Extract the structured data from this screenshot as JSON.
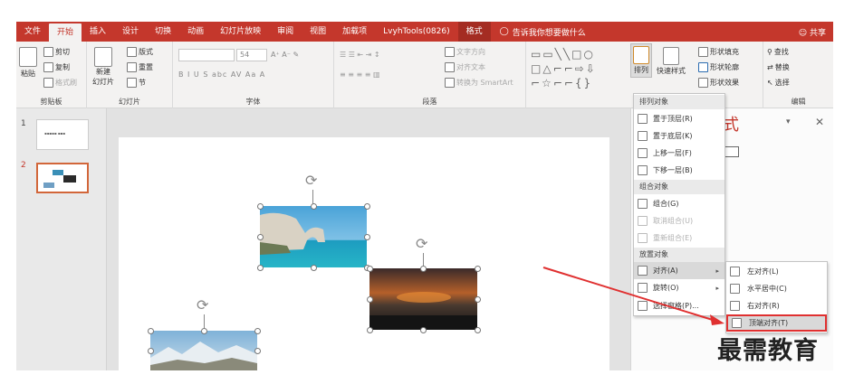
{
  "ribbon_tabs": [
    "文件",
    "开始",
    "插入",
    "设计",
    "切换",
    "动画",
    "幻灯片放映",
    "审阅",
    "视图",
    "加载项",
    "LvyhTools(0826)",
    "格式"
  ],
  "tell_me": "告诉我你想要做什么",
  "share": "共享",
  "clipboard": {
    "paste": "粘贴",
    "cut": "剪切",
    "copy": "复制",
    "format_painter": "格式刷",
    "label": "剪贴板"
  },
  "slides_group": {
    "new_slide": "新建",
    "new_slide2": "幻灯片",
    "layout": "版式",
    "reset": "重置",
    "section": "节",
    "label": "幻灯片"
  },
  "font_group": {
    "size": "54",
    "label": "字体",
    "buttons": "B  I  U  S  abc  AV  Aa  A"
  },
  "paragraph_group": {
    "text_direction": "文字方向",
    "align_text": "对齐文本",
    "smartart": "转换为 SmartArt",
    "label": "段落"
  },
  "drawing_group": {
    "arrange": "排列",
    "quick_styles": "快速样式",
    "shape_fill": "形状填充",
    "shape_outline": "形状轮廓",
    "shape_effects": "形状效果"
  },
  "editing_group": {
    "find": "查找",
    "replace": "替换",
    "select": "选择",
    "label": "编辑"
  },
  "slides_pane": {
    "slide1_num": "1",
    "slide2_num": "2"
  },
  "format_pane": {
    "title": "式"
  },
  "arrange_menu": {
    "head_order": "排列对象",
    "bring_front": "置于顶层(R)",
    "send_back": "置于底层(K)",
    "bring_forward": "上移一层(F)",
    "send_backward": "下移一层(B)",
    "head_group": "组合对象",
    "group": "组合(G)",
    "ungroup": "取消组合(U)",
    "regroup": "重新组合(E)",
    "head_place": "放置对象",
    "align": "对齐(A)",
    "rotate": "旋转(O)",
    "selection_pane": "选择窗格(P)..."
  },
  "align_submenu": {
    "left": "左对齐(L)",
    "center": "水平居中(C)",
    "right": "右对齐(R)",
    "top": "顶端对齐(T)"
  },
  "watermark": "最需教育",
  "colors": {
    "ribbon_red": "#c4372c",
    "highlight_box": "#e03030"
  }
}
